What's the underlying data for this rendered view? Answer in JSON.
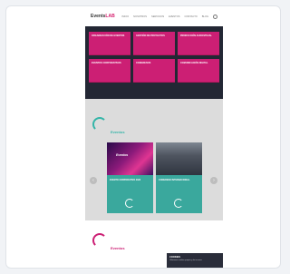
{
  "header": {
    "logo_text": "Events",
    "logo_mark": "LAB",
    "nav": [
      "INICIO",
      "NOSOTROS",
      "SERVICIOS",
      "EVENTOS",
      "CONTACTO",
      "BLOG"
    ]
  },
  "tiles": [
    {
      "label": "ORGANIZACIÓN DE EVENTOS"
    },
    {
      "label": "GESTIÓN DE PROYECTOS"
    },
    {
      "label": "PRODUCCIÓN AUDIOVISUAL"
    },
    {
      "label": "EVENTOS CORPORATIVOS"
    },
    {
      "label": "CONGRESOS"
    },
    {
      "label": "COMUNICACIÓN DIGITAL"
    }
  ],
  "section_projects": {
    "title": "Eventos",
    "slides": [
      {
        "badge": "Eventos",
        "caption": "EVENTO CORPORATIVO 2023"
      },
      {
        "badge": "",
        "caption": "CONGRESO INTERNACIONAL"
      }
    ]
  },
  "section_bottom": {
    "title": "Eventos"
  },
  "cookie": {
    "title": "COOKIES",
    "text": "Utilizamos cookies propias y de terceros"
  },
  "colors": {
    "accent": "#cc1f74",
    "teal": "#34b5a8",
    "dark": "#232734"
  }
}
